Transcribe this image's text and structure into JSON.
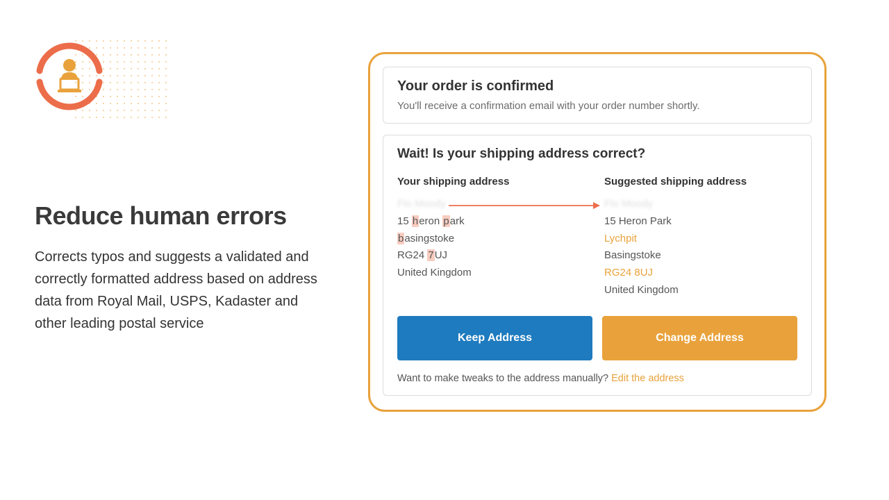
{
  "left": {
    "headline": "Reduce human errors",
    "description": "Corrects typos and suggests a validated and correctly formatted address based on address data from Royal Mail, USPS, Kadaster and other leading postal service"
  },
  "confirm": {
    "title": "Your order is confirmed",
    "subtitle": "You'll receive a confirmation email with your order number shortly."
  },
  "validator": {
    "heading": "Wait! Is your shipping address correct?",
    "your_label": "Your shipping address",
    "suggested_label": "Suggested shipping address",
    "your": {
      "name_blur": "Flo Moody",
      "line1_pre": "15 ",
      "line1_hl1": "h",
      "line1_mid": "eron ",
      "line1_hl2": "p",
      "line1_post": "ark",
      "line2_hl": "b",
      "line2_rest": "asingstoke",
      "line3_pre": "RG24 ",
      "line3_hl": "7",
      "line3_post": "UJ",
      "country": "United Kingdom"
    },
    "suggested": {
      "name_blur": "Flo Moody",
      "line1": "15 Heron Park",
      "line2": "Lychpit",
      "line3": "Basingstoke",
      "line4": "RG24 8UJ",
      "country": "United Kingdom"
    },
    "keep_btn": "Keep Address",
    "change_btn": "Change Address",
    "tweaks_text": "Want to make tweaks to the address manually? ",
    "edit_link": "Edit the address"
  },
  "colors": {
    "accent_orange": "#e9a23b",
    "accent_coral": "#ec6d4a",
    "btn_blue": "#1e7bbf"
  }
}
